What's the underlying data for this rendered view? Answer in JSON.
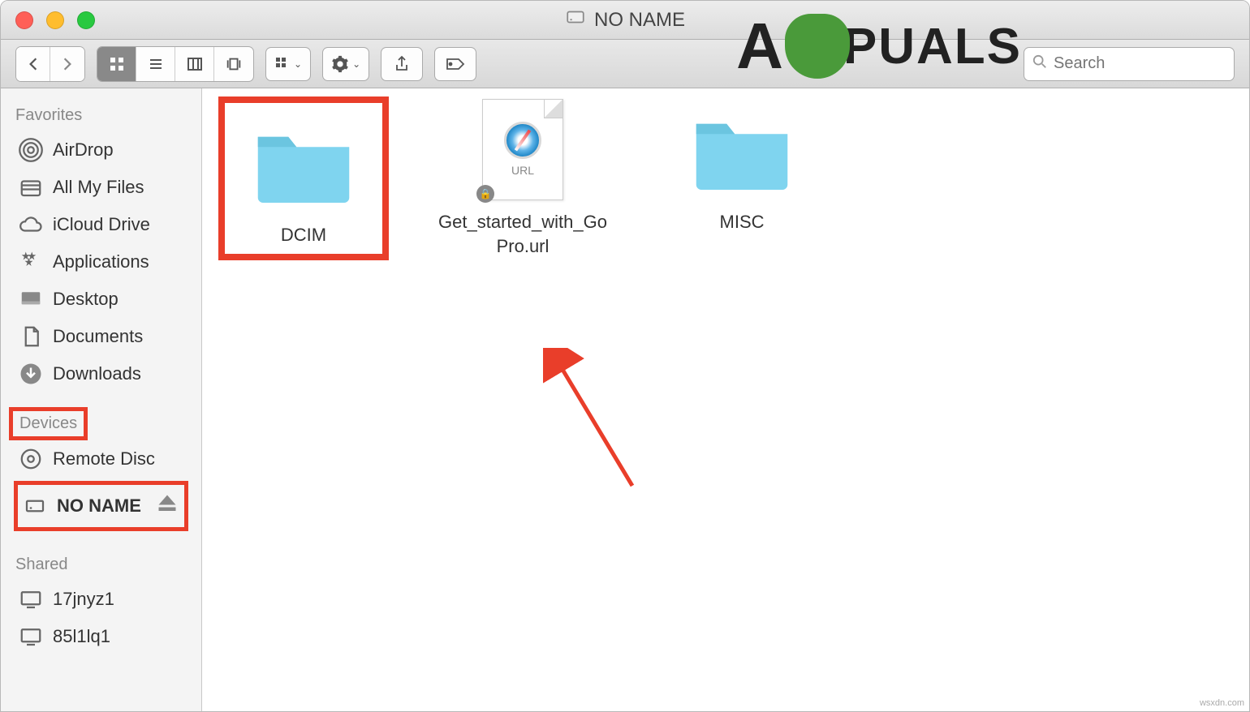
{
  "window": {
    "title": "NO NAME"
  },
  "search": {
    "placeholder": "Search"
  },
  "logo_text": "PUALS",
  "sidebar": {
    "favorites_label": "Favorites",
    "devices_label": "Devices",
    "shared_label": "Shared",
    "favorites": [
      {
        "label": "AirDrop",
        "icon": "airdrop"
      },
      {
        "label": "All My Files",
        "icon": "allfiles"
      },
      {
        "label": "iCloud Drive",
        "icon": "icloud"
      },
      {
        "label": "Applications",
        "icon": "apps"
      },
      {
        "label": "Desktop",
        "icon": "desktop"
      },
      {
        "label": "Documents",
        "icon": "documents"
      },
      {
        "label": "Downloads",
        "icon": "downloads"
      }
    ],
    "devices": [
      {
        "label": "Remote Disc",
        "icon": "disc",
        "ejectable": false,
        "highlighted": false
      },
      {
        "label": "NO NAME",
        "icon": "drive",
        "ejectable": true,
        "highlighted": true
      }
    ],
    "shared": [
      {
        "label": "17jnyz1",
        "icon": "monitor"
      },
      {
        "label": "85l1lq1",
        "icon": "monitor"
      }
    ]
  },
  "files": [
    {
      "name": "DCIM",
      "type": "folder",
      "highlighted": true
    },
    {
      "name": "Get_started_with_GoPro.url",
      "type": "url",
      "url_tag": "URL",
      "highlighted": false
    },
    {
      "name": "MISC",
      "type": "folder",
      "highlighted": false
    }
  ],
  "watermark": "wsxdn.com",
  "colors": {
    "highlight_red": "#e93e2a",
    "folder_blue": "#7fd4ef"
  }
}
